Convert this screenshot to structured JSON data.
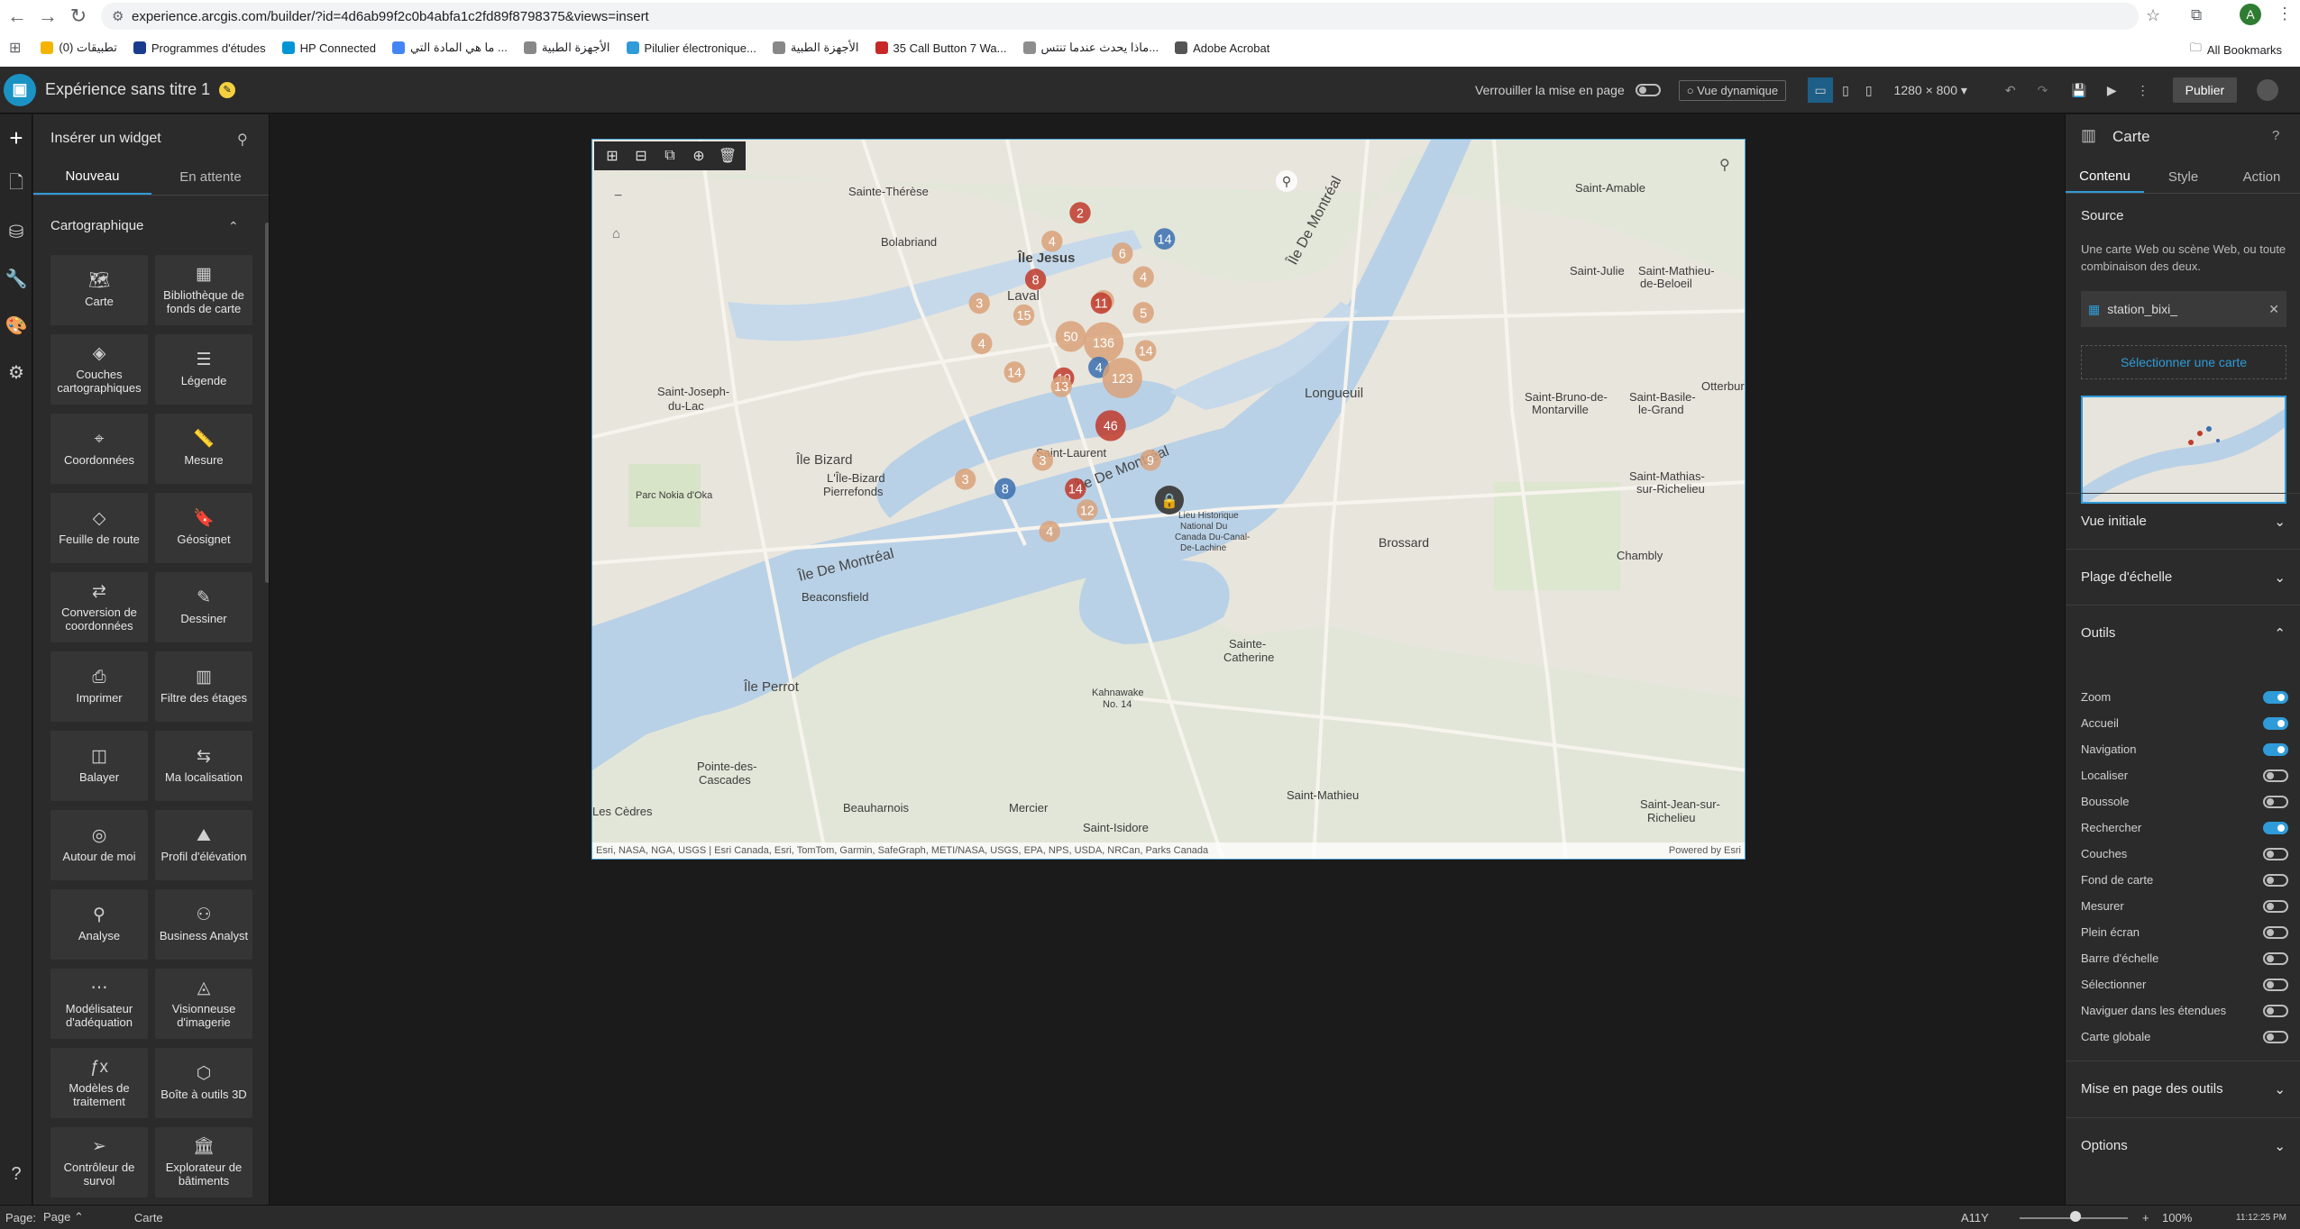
{
  "browser": {
    "url": "experience.arcgis.com/builder/?id=4d6ab99f2c0b4abfa1c2fd89f8798375&views=insert",
    "profile_initial": "A",
    "bookmarks": [
      {
        "label": "تطبيقات (0)",
        "color": "#f4b400"
      },
      {
        "label": "Programmes d'études",
        "color": "#1a3c8f"
      },
      {
        "label": "HP Connected",
        "color": "#0096d6"
      },
      {
        "label": "ما هي المادة التي ...",
        "color": "#4285f4"
      },
      {
        "label": "الأجهزة الطبية",
        "color": "#888888"
      },
      {
        "label": "Pilulier électronique...",
        "color": "#2f9bd8"
      },
      {
        "label": "الأجهزة الطبية",
        "color": "#888888"
      },
      {
        "label": "35 Call Button 7 Wa...",
        "color": "#c62828"
      },
      {
        "label": "ماذا يحدث عندما تنتس...",
        "color": "#8e8e8e"
      },
      {
        "label": "Adobe Acrobat",
        "color": "#555555"
      }
    ],
    "all_bookmarks": "All Bookmarks"
  },
  "header": {
    "title": "Expérience sans titre 1",
    "lock_label": "Verrouiller la mise en page",
    "dynamic_view": "Vue dynamique",
    "resolution": "1280 × 800",
    "publish": "Publier"
  },
  "widget_panel": {
    "title": "Insérer un widget",
    "tabs": [
      "Nouveau",
      "En attente"
    ],
    "category": "Cartographique",
    "widgets": [
      {
        "label": "Carte",
        "icon": "map-icon",
        "glyph": "🗺"
      },
      {
        "label": "Bibliothèque de fonds de carte",
        "icon": "basemap-gallery-icon",
        "glyph": "▦"
      },
      {
        "label": "Couches cartographiques",
        "icon": "layers-icon",
        "glyph": "◈"
      },
      {
        "label": "Légende",
        "icon": "legend-icon",
        "glyph": "☰"
      },
      {
        "label": "Coordonnées",
        "icon": "coordinates-icon",
        "glyph": "⌖"
      },
      {
        "label": "Mesure",
        "icon": "measure-icon",
        "glyph": "📏"
      },
      {
        "label": "Feuille de route",
        "icon": "directions-icon",
        "glyph": "◇"
      },
      {
        "label": "Géosignet",
        "icon": "bookmark-icon",
        "glyph": "🔖"
      },
      {
        "label": "Conversion de coordonnées",
        "icon": "coordinate-conversion-icon",
        "glyph": "⇄"
      },
      {
        "label": "Dessiner",
        "icon": "draw-icon",
        "glyph": "✎"
      },
      {
        "label": "Imprimer",
        "icon": "print-icon",
        "glyph": "⎙"
      },
      {
        "label": "Filtre des étages",
        "icon": "floor-filter-icon",
        "glyph": "▥"
      },
      {
        "label": "Balayer",
        "icon": "swipe-icon",
        "glyph": "◫"
      },
      {
        "label": "Ma localisation",
        "icon": "my-location-icon",
        "glyph": "⇆"
      },
      {
        "label": "Autour de moi",
        "icon": "near-me-icon",
        "glyph": "◎"
      },
      {
        "label": "Profil d'élévation",
        "icon": "elevation-profile-icon",
        "glyph": "⛰"
      },
      {
        "label": "Analyse",
        "icon": "analysis-icon",
        "glyph": "⚲"
      },
      {
        "label": "Business Analyst",
        "icon": "business-analyst-icon",
        "glyph": "⚇"
      },
      {
        "label": "Modélisateur d'adéquation",
        "icon": "suitability-modeler-icon",
        "glyph": "⋯"
      },
      {
        "label": "Visionneuse d'imagerie",
        "icon": "imagery-viewer-icon",
        "glyph": "◬"
      },
      {
        "label": "Modèles de traitement",
        "icon": "processing-templates-icon",
        "glyph": "ƒx"
      },
      {
        "label": "Boîte à outils 3D",
        "icon": "3d-toolbox-icon",
        "glyph": "⬡"
      },
      {
        "label": "Contrôleur de survol",
        "icon": "fly-controller-icon",
        "glyph": "➢"
      },
      {
        "label": "Explorateur de bâtiments",
        "icon": "building-explorer-icon",
        "glyph": "🏛"
      }
    ]
  },
  "map": {
    "attribution": "Esri, NASA, NGA, USGS | Esri Canada, Esri, TomTom, Garmin, SafeGraph, METI/NASA, USGS, EPA, NPS, USDA, NRCan, Parks Canada",
    "powered_by": "Powered by Esri",
    "labels": [
      "Sainte-Thérèse",
      "Bolabriand",
      "Île Jesus",
      "Laval",
      "Saint-Joseph-du-Lac",
      "Île Bizard",
      "L'Île-Bizard Pierrefonds",
      "Parc Nokia d'Oka",
      "Saint-Laurent",
      "Île De Montréal",
      "Longueuil",
      "Brossard",
      "Beaconsfield",
      "Île Perrot",
      "Sainte-Catherine",
      "Kahnawake No. 14",
      "Pointe-des-Cascades",
      "Beauharnois",
      "Mercier",
      "Saint-Isidore",
      "Saint-Mathieu",
      "Saint-Jean-sur-Richelieu",
      "Chambly",
      "Saint-Mathias-sur-Richelieu",
      "Saint-Bruno-de-Montarville",
      "Saint-Basile-le-Grand",
      "Saint-Julie",
      "Saint-Mathieu-de-Beloeil",
      "Saint-Amable",
      "Otterburn",
      "Les Cèdres",
      "Lieu Historique National Du Canada Du-Canal-De-Lachine"
    ],
    "clusters": [
      "2",
      "4",
      "6",
      "14",
      "3",
      "8",
      "11",
      "4",
      "5",
      "15",
      "11",
      "50",
      "136",
      "4",
      "14",
      "10",
      "14",
      "4",
      "13",
      "123",
      "46",
      "3",
      "9",
      "3",
      "8",
      "14",
      "12",
      "4"
    ]
  },
  "right_panel": {
    "title": "Carte",
    "tabs": [
      "Contenu",
      "Style",
      "Action"
    ],
    "source_label": "Source",
    "source_desc": "Une carte Web ou scène Web, ou toute combinaison des deux.",
    "source_item": "station_bixi_",
    "select_map": "Sélectionner une carte",
    "sections": [
      "Vue initiale",
      "Plage d'échelle",
      "Outils"
    ],
    "tools": [
      {
        "label": "Zoom",
        "on": true
      },
      {
        "label": "Accueil",
        "on": true
      },
      {
        "label": "Navigation",
        "on": true
      },
      {
        "label": "Localiser",
        "on": false
      },
      {
        "label": "Boussole",
        "on": false
      },
      {
        "label": "Rechercher",
        "on": true
      },
      {
        "label": "Couches",
        "on": false
      },
      {
        "label": "Fond de carte",
        "on": false
      },
      {
        "label": "Mesurer",
        "on": false
      },
      {
        "label": "Plein écran",
        "on": false
      },
      {
        "label": "Barre d'échelle",
        "on": false
      },
      {
        "label": "Sélectionner",
        "on": false
      },
      {
        "label": "Naviguer dans les étendues",
        "on": false
      },
      {
        "label": "Carte globale",
        "on": false
      }
    ],
    "bottom_sections": [
      "Mise en page des outils",
      "Options"
    ]
  },
  "status": {
    "page_label": "Page:",
    "page_value": "Page",
    "widget": "Carte",
    "a11y": "A11Y",
    "zoom": "100%",
    "time": "11:12:25 PM"
  }
}
